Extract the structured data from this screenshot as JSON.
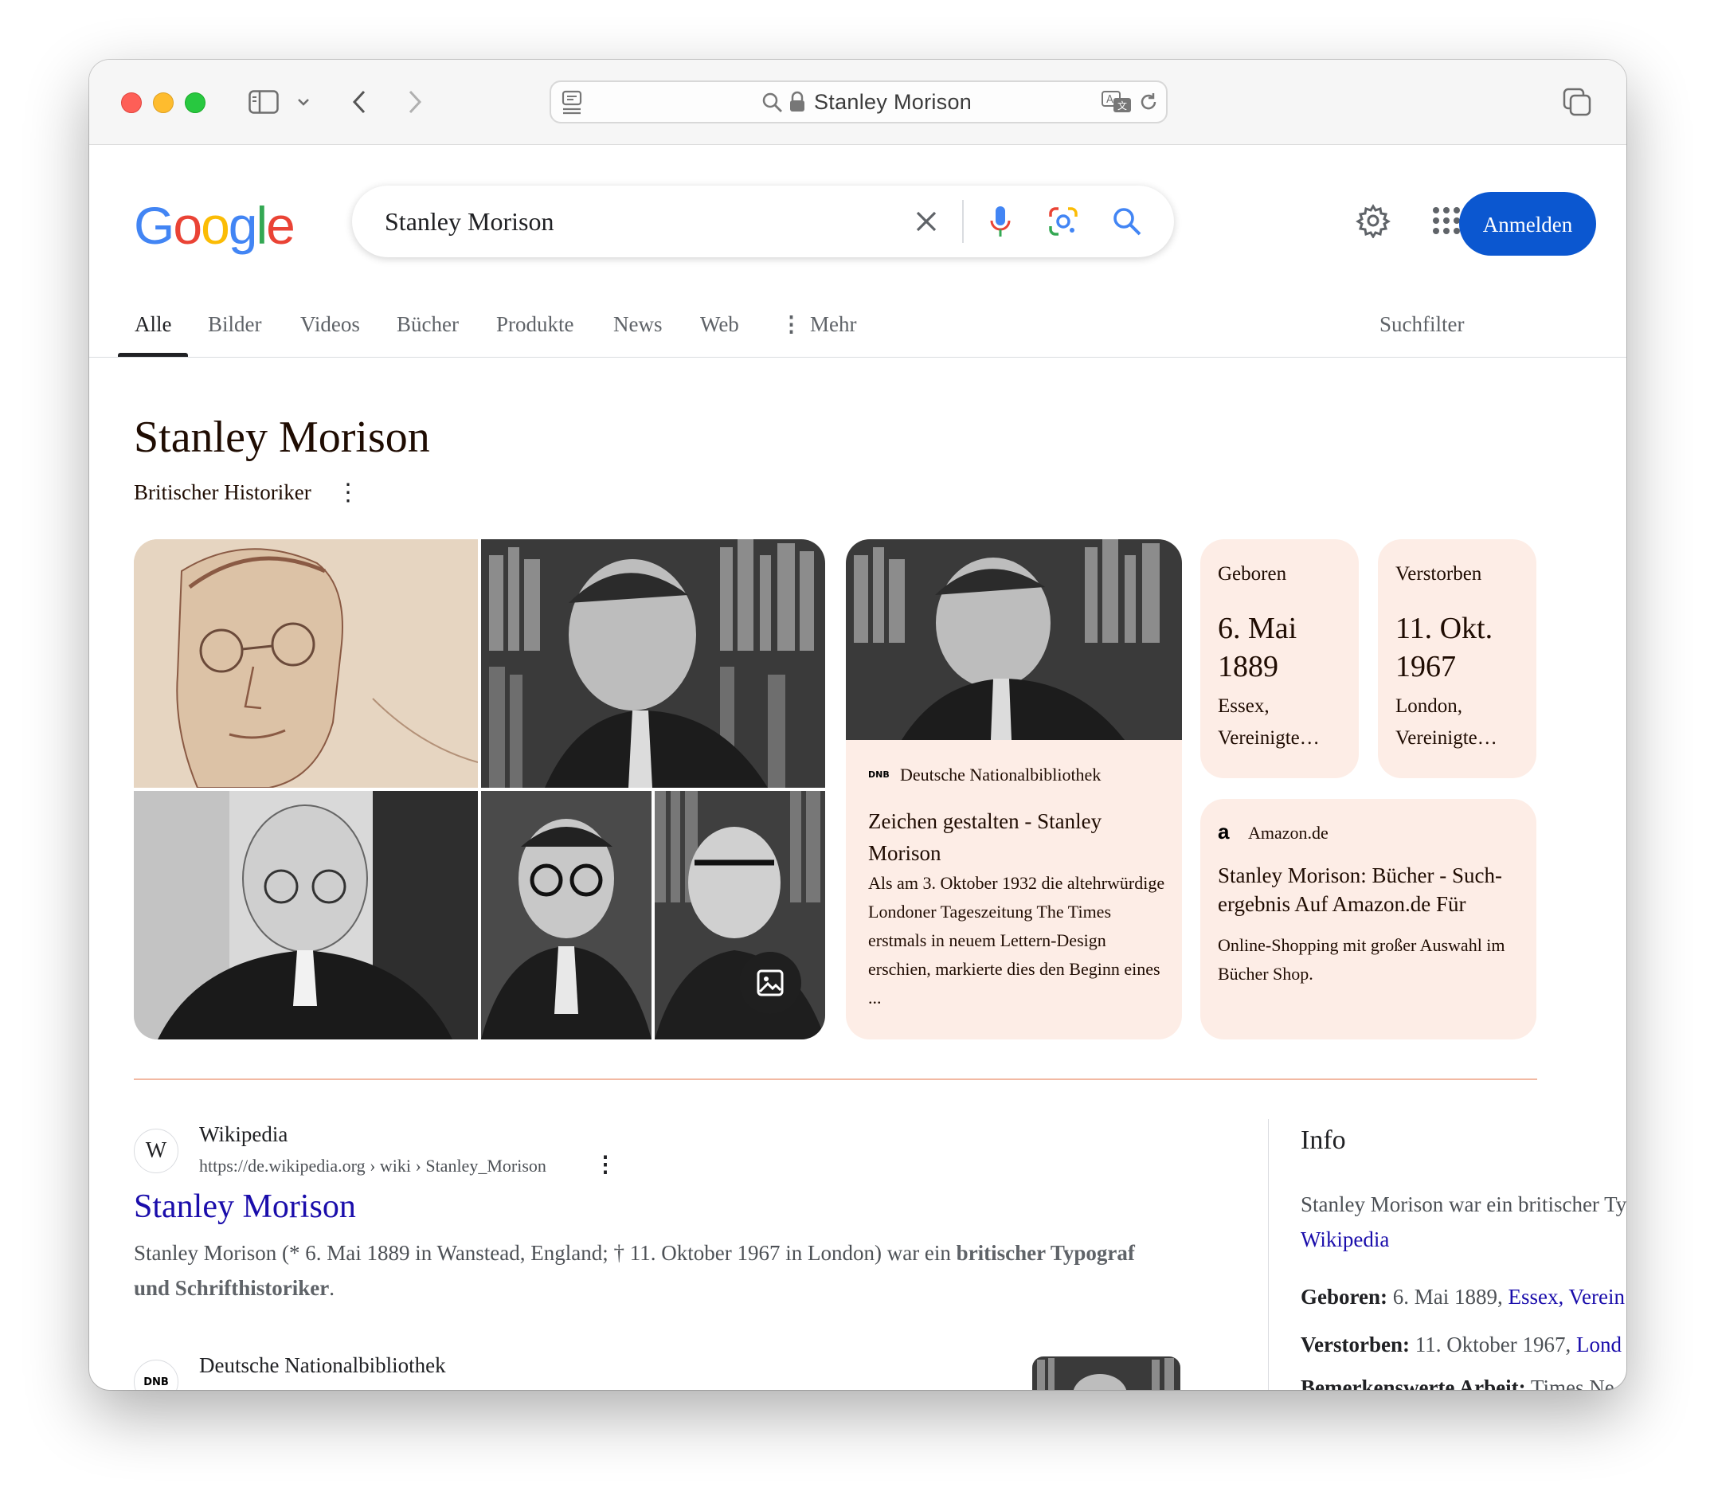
{
  "browser": {
    "url_text": "Stanley Morison"
  },
  "search": {
    "query": "Stanley Morison",
    "signin_label": "Anmelden"
  },
  "tabs": {
    "items": [
      "Alle",
      "Bilder",
      "Videos",
      "Bücher",
      "Produkte",
      "News",
      "Web",
      "Mehr"
    ],
    "filter_label": "Suchfilter"
  },
  "knowledge": {
    "title": "Stanley Morison",
    "subtitle": "Britischer Historiker",
    "image_card": {
      "source": "Deutsche Nationalbibliothek",
      "source_abbr": "DNB",
      "title": "Zeichen gestalten - Stanley Morison",
      "snippet": "Als am 3. Oktober 1932 die altehrwürdige Londoner Tageszeitung The Times erstmals in neuem Lettern-Design erschien, markierte dies den Beginn eines ..."
    },
    "born": {
      "label": "Geboren",
      "date_line1": "6. Mai",
      "date_line2": "1889",
      "place_line1": "Essex,",
      "place_line2": "Vereinigte…"
    },
    "died": {
      "label": "Verstorben",
      "date_line1": "11. Okt.",
      "date_line2": "1967",
      "place_line1": "London,",
      "place_line2": "Vereinigte…"
    },
    "amazon": {
      "source": "Amazon.de",
      "title": "Stanley Morison: Bücher - Such­ergebnis Auf Amazon.de Für",
      "snippet": "Online-Shopping mit großer Auswahl im Bücher Shop."
    }
  },
  "results": [
    {
      "site": "Wikipedia",
      "url": "https://de.wikipedia.org › wiki › Stanley_Morison",
      "title": "Stanley Morison",
      "snippet_plain": "Stanley Morison (* 6. Mai 1889 in Wanstead, England; † 11. Oktober 1967 in London) war ein ",
      "snippet_bold": "britischer Typograf und Schrifthistoriker",
      "snippet_end": "."
    },
    {
      "site": "Deutsche Nationalbibliothek",
      "favicon_text": "DNB"
    }
  ],
  "info": {
    "heading": "Info",
    "intro": "Stanley Morison war ein britischer Ty",
    "intro_link": "Wikipedia",
    "born_label": "Geboren:",
    "born_value": " 6. Mai 1889, ",
    "born_link": "Essex, Verein",
    "died_label": "Verstorben:",
    "died_value": " 11. Oktober 1967, ",
    "died_link": "Lond",
    "work_label": "Bemerkenswerte Arbeit:",
    "work_value": " Times Ne"
  },
  "colors": {
    "accent_blue": "#0b57d0",
    "link_blue": "#1a0dab",
    "card_bg": "#fdede6",
    "divider": "#f2b9a3"
  }
}
